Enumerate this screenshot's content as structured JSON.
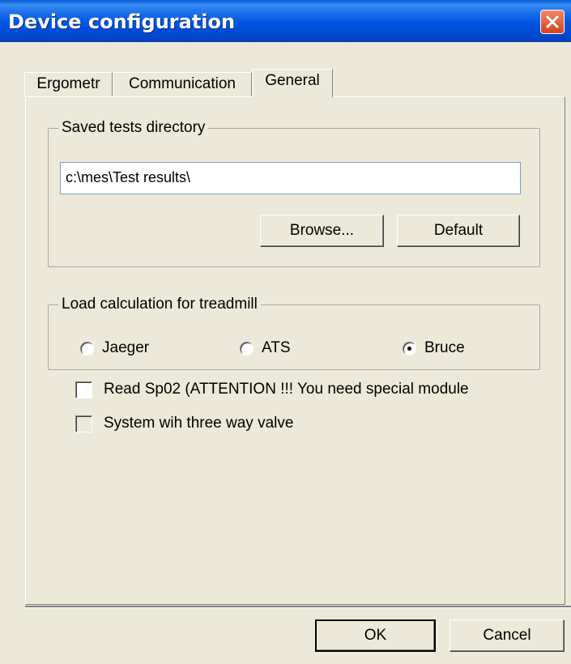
{
  "window": {
    "title": "Device configuration",
    "close_icon": "close-icon"
  },
  "tabs": [
    {
      "label": "Ergometr",
      "active": false
    },
    {
      "label": "Communication",
      "active": false
    },
    {
      "label": "General",
      "active": true
    }
  ],
  "saved_tests": {
    "legend": "Saved tests directory",
    "path_value": "c:\\mes\\Test results\\",
    "browse_label": "Browse...",
    "default_label": "Default"
  },
  "load_calc": {
    "legend": "Load calculation for treadmill",
    "options": [
      {
        "label": "Jaeger",
        "checked": false
      },
      {
        "label": "ATS",
        "checked": false
      },
      {
        "label": "Bruce",
        "checked": true
      }
    ]
  },
  "checkboxes": [
    {
      "label": "Read Sp02 (ATTENTION !!! You need special module",
      "checked": false,
      "enabled": true
    },
    {
      "label": "System wih three way valve",
      "checked": false,
      "enabled": false
    }
  ],
  "footer": {
    "ok_label": "OK",
    "cancel_label": "Cancel"
  }
}
